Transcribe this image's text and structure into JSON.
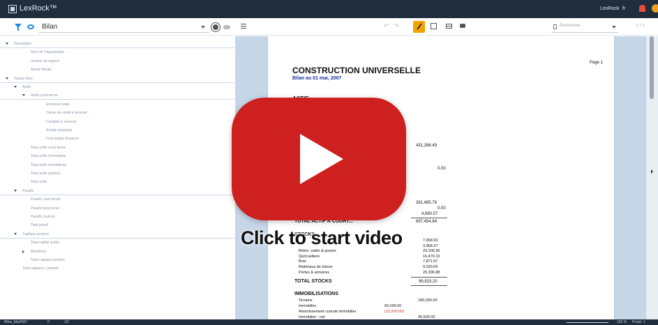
{
  "app": {
    "title": "LexRock™",
    "user": "LexRock",
    "language": "fr",
    "bell_icon": "bell-icon",
    "avatar_icon": "user-avatar"
  },
  "left_toolbar": {
    "filter_icon": "filter-icon",
    "eye_icon": "eye-icon",
    "report_select": "Bilan",
    "gear_icon": "gear-icon",
    "cloud_icon": "cloud-icon"
  },
  "tree": {
    "items": [
      {
        "label": "Description",
        "level": 0,
        "expanded": true
      },
      {
        "label": "Nom de l'organisation",
        "level": 2
      },
      {
        "label": "Version du rapport",
        "level": 2
      },
      {
        "label": "Année fiscale",
        "level": 2
      },
      {
        "label": "Totaux bilan",
        "level": 0,
        "expanded": true
      },
      {
        "label": "Actifs",
        "level": 1,
        "expanded": true
      },
      {
        "label": "Actifs court terme",
        "level": 2,
        "expanded": true
      },
      {
        "label": "Encaisse totale",
        "level": 3
      },
      {
        "label": "Cartes de crédit à recevoir",
        "level": 3
      },
      {
        "label": "Comptes à recevoir",
        "level": 3
      },
      {
        "label": "Achats prépayés",
        "level": 3
      },
      {
        "label": "Frais payés d'avance",
        "level": 3
      },
      {
        "label": "Total actifs court terme",
        "level": 2
      },
      {
        "label": "Total actifs d'inventaire",
        "level": 2
      },
      {
        "label": "Total actifs immobilisés",
        "level": 2
      },
      {
        "label": "Total actifs (autres)",
        "level": 2
      },
      {
        "label": "Total actifs",
        "level": 2
      },
      {
        "label": "Passifs",
        "level": 1,
        "expanded": true
      },
      {
        "label": "Passifs court terme",
        "level": 2
      },
      {
        "label": "Passifs long terme",
        "level": 2
      },
      {
        "label": "Passifs (autres)",
        "level": 2
      },
      {
        "label": "Total passif",
        "level": 2
      },
      {
        "label": "Capitaux propres",
        "level": 1,
        "expanded": true
      },
      {
        "label": "Total capital action",
        "level": 2
      },
      {
        "label": "Bénéfices",
        "level": 2,
        "collapsed": true
      },
      {
        "label": "Total capitaux propres",
        "level": 2
      },
      {
        "label": "Total capitaux + passifs",
        "level": 1
      }
    ]
  },
  "main_toolbar": {
    "menu_icon": "menu-icon",
    "undo_icon": "undo-icon",
    "redo_icon": "redo-icon",
    "pen_icon": "pen-icon",
    "crop_icon": "crop-icon",
    "table_icon": "table-icon",
    "comment_icon": "comment-icon",
    "search_placeholder": "Recherche",
    "page_count": "1 / 1"
  },
  "document": {
    "company": "CONSTRUCTION UNIVERSELLE",
    "subtitle": "Bilan au 01 mai, 2007",
    "page_label": "Page 1",
    "sections": {
      "actif": "ACTIF",
      "total_actif_court": "TOTAL ACTIF À COURT...",
      "stocks": "STOCKS",
      "total_stocks": "TOTAL STOCKS",
      "immobilisations": "IMMOBILISATIONS"
    },
    "amounts": {
      "a1": "431,288.49",
      "a2": "0.00",
      "a3": "261,485.76",
      "a4": "0.00",
      "a5": "4,680.57",
      "a6": "697,454.84"
    },
    "stock_lines": [
      {
        "label": "",
        "value": "7,968.93"
      },
      {
        "label": "",
        "value": "3,968.37"
      },
      {
        "label": "Béton, sable & gravier",
        "value": "29,206.95"
      },
      {
        "label": "Quincaillerie",
        "value": "16,470.15"
      },
      {
        "label": "Bois",
        "value": "7,871.97"
      },
      {
        "label": "Matériaux de toiture",
        "value": "9,030.00"
      },
      {
        "label": "Portes & armoires",
        "value": "25,306.88"
      }
    ],
    "total_stocks_value": "99,923.20",
    "immo_lines": [
      {
        "label": "Terrains",
        "sub": "",
        "value": "180,000.00"
      },
      {
        "label": "Immobilier",
        "sub": "60,000.00",
        "value": ""
      },
      {
        "label": "Amortissement cumulé immobilier",
        "sub": "(10,500.00)",
        "value": ""
      },
      {
        "label": "Immobilier : net",
        "sub": "",
        "value": "49,500.00"
      }
    ]
  },
  "statusbar": {
    "left_text": "Bilan_Mai2007",
    "count_text": "0",
    "page_text": "1/2",
    "zoom_text": "150 %",
    "project_text": "Projet: 1"
  },
  "video_overlay": {
    "icon": "play-button-icon",
    "caption": "Click to start video"
  }
}
